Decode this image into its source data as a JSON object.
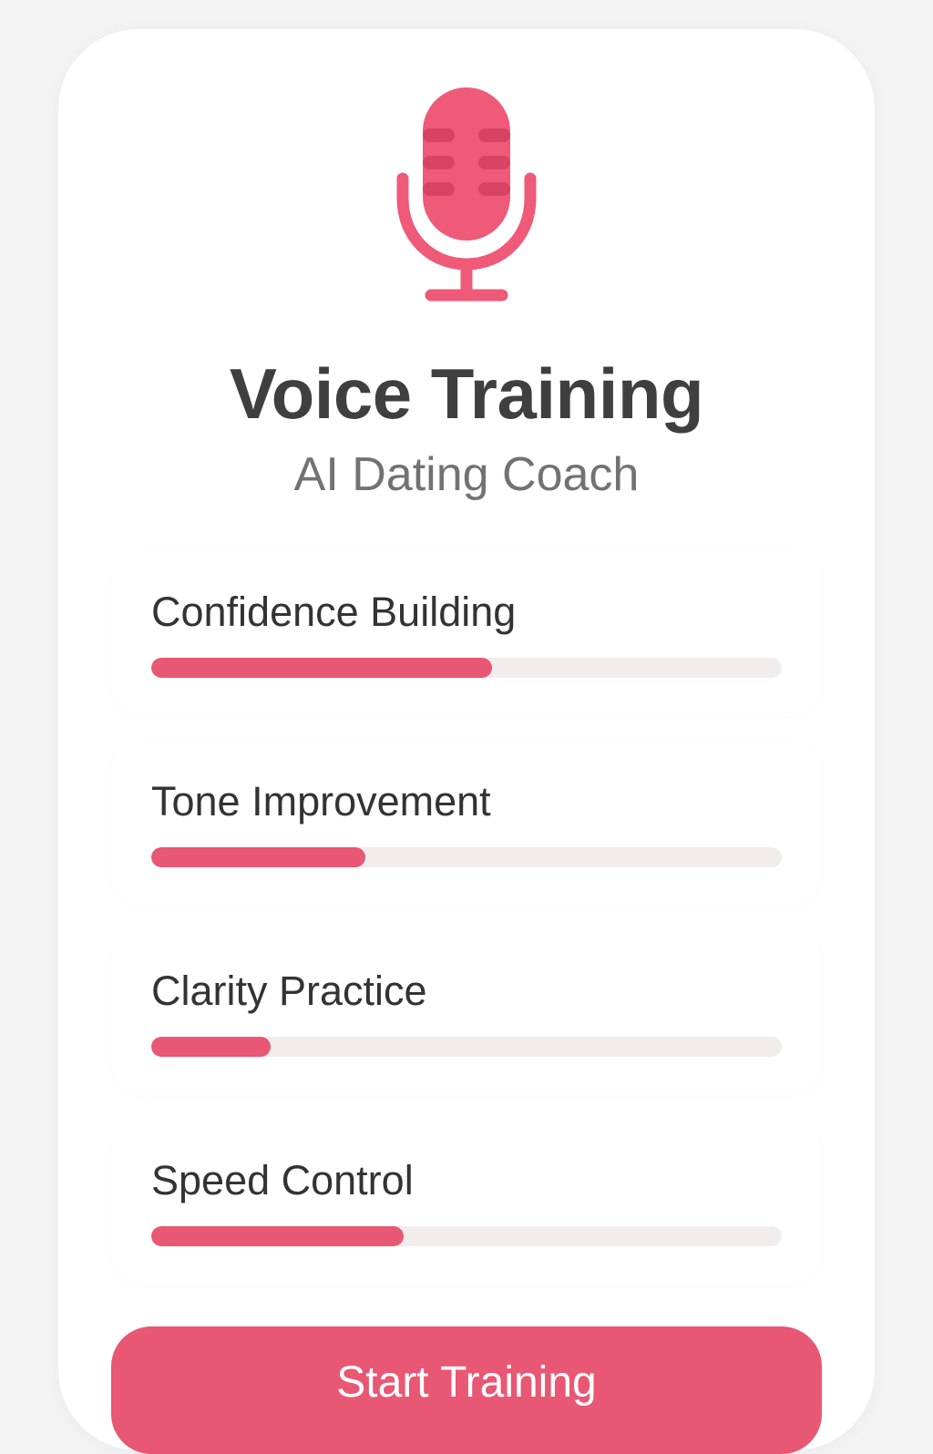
{
  "header": {
    "icon": "microphone-icon",
    "title": "Voice Training",
    "subtitle": "AI Dating Coach"
  },
  "skills": [
    {
      "label": "Confidence Building",
      "progress": 0.54
    },
    {
      "label": "Tone Improvement",
      "progress": 0.34
    },
    {
      "label": "Clarity Practice",
      "progress": 0.19
    },
    {
      "label": "Speed Control",
      "progress": 0.4
    }
  ],
  "actions": {
    "start_label": "Start Training"
  },
  "colors": {
    "accent": "#e85773",
    "track": "#f1eded",
    "text": "#333333",
    "muted": "#727272",
    "background": "#f3f3f3"
  }
}
